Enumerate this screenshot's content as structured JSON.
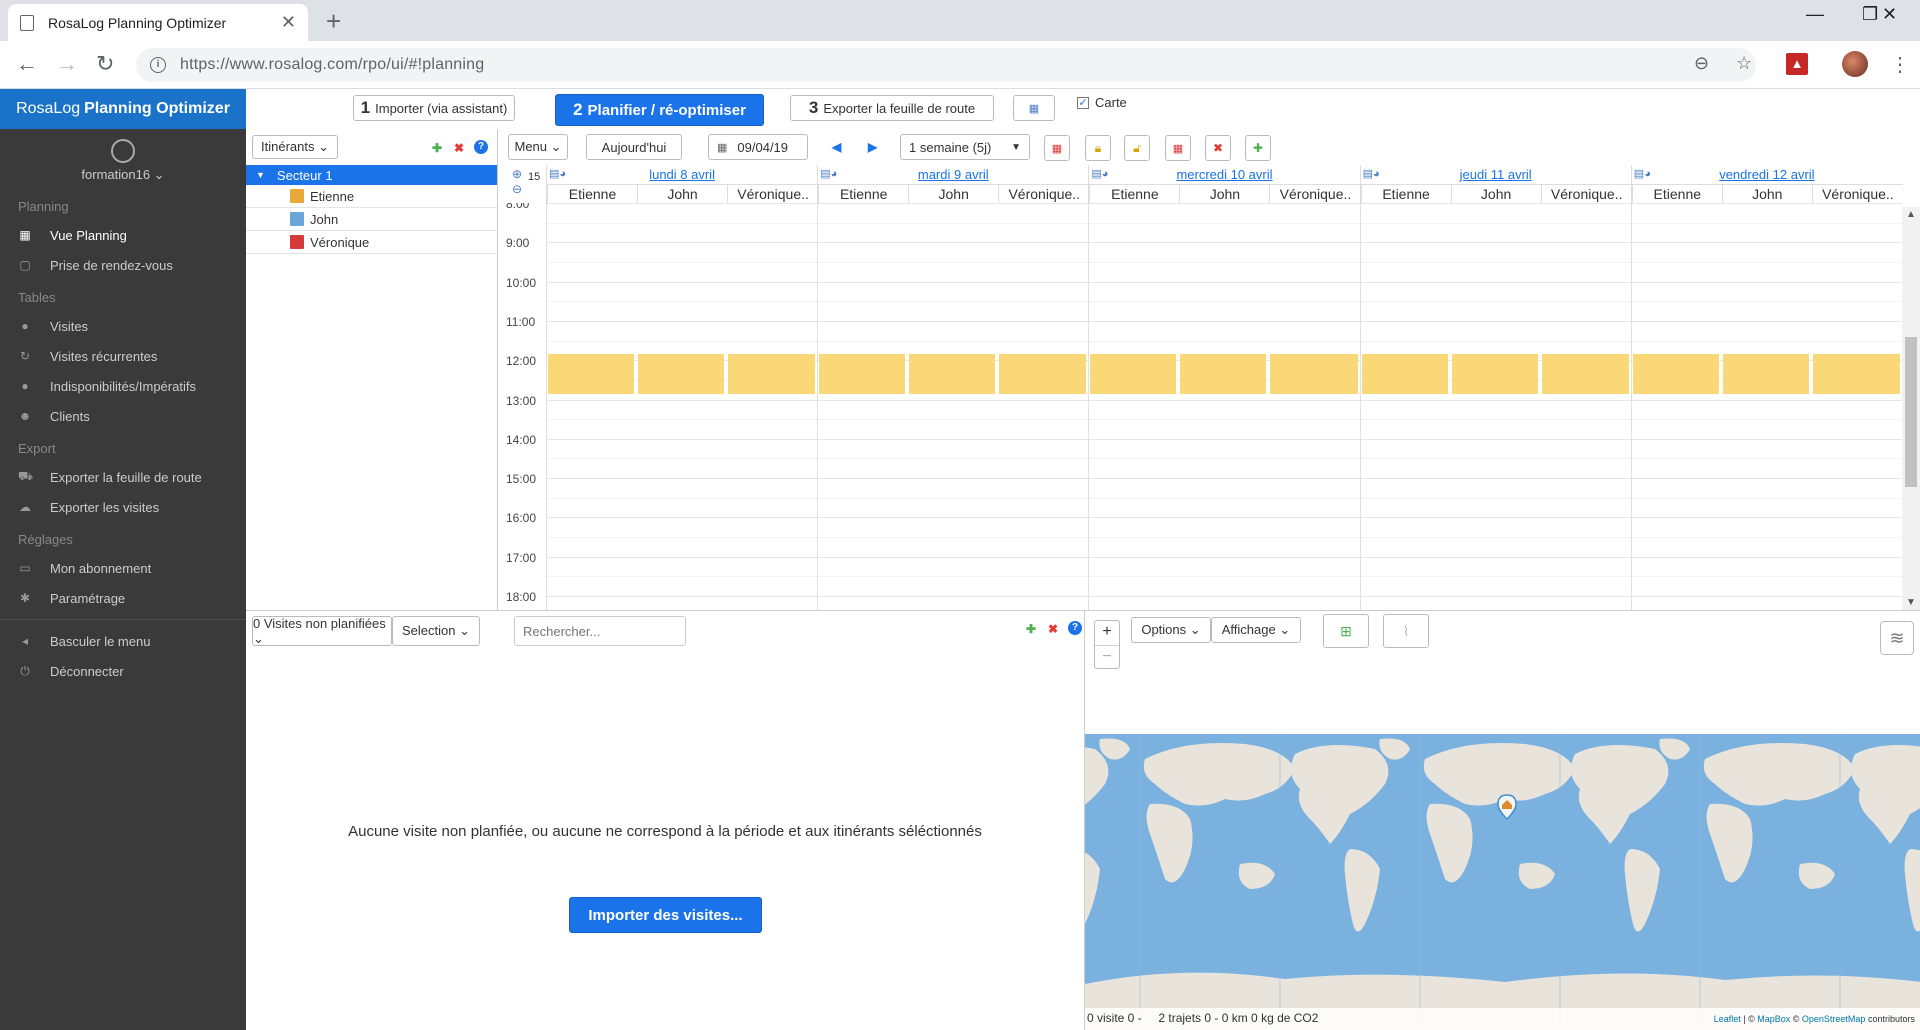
{
  "browser": {
    "tab_title": "RosaLog Planning Optimizer",
    "url": "https://www.rosalog.com/rpo/ui/#!planning"
  },
  "sidebar": {
    "brand_prefix": "RosaLog",
    "brand_suffix": "Planning Optimizer",
    "user": "formation16 ⌄",
    "sections": [
      {
        "title": "Planning",
        "items": [
          {
            "label": "Vue Planning",
            "icon": "calendar-icon",
            "active": true
          },
          {
            "label": "Prise de rendez-vous",
            "icon": "calendar-outline-icon"
          }
        ]
      },
      {
        "title": "Tables",
        "items": [
          {
            "label": "Visites",
            "icon": "map-pin-icon"
          },
          {
            "label": "Visites récurrentes",
            "icon": "refresh-icon"
          },
          {
            "label": "Indisponibilités/Impératifs",
            "icon": "alert-circle-icon"
          },
          {
            "label": "Clients",
            "icon": "users-icon"
          }
        ]
      },
      {
        "title": "Export",
        "items": [
          {
            "label": "Exporter la feuille de route",
            "icon": "car-icon"
          },
          {
            "label": "Exporter les visites",
            "icon": "cloud-upload-icon"
          }
        ]
      },
      {
        "title": "Réglages",
        "items": [
          {
            "label": "Mon abonnement",
            "icon": "credit-card-icon"
          },
          {
            "label": "Paramétrage",
            "icon": "gear-icon"
          }
        ]
      }
    ],
    "footer_items": [
      {
        "label": "Basculer le menu",
        "icon": "caret-left-icon"
      },
      {
        "label": "Déconnecter",
        "icon": "power-icon"
      }
    ]
  },
  "toolbar": {
    "step1_num": "1",
    "step1_label": "Importer (via assistant)",
    "step2_num": "2",
    "step2_label": "Planifier / ré-optimiser",
    "step3_num": "3",
    "step3_label": "Exporter la feuille de route",
    "carte_label": "Carte"
  },
  "resources": {
    "dropdown": "Itinérants ⌄",
    "sector": "Secteur 1",
    "people": [
      {
        "name": "Etienne",
        "color": "#e8a93c"
      },
      {
        "name": "John",
        "color": "#6aa6d8"
      },
      {
        "name": "Véronique",
        "color": "#d43a3a"
      }
    ]
  },
  "calendar": {
    "menu_label": "Menu ⌄",
    "today_label": "Aujourd'hui",
    "date_value": "09/04/19",
    "range_label": "1 semaine (5j)",
    "zoom_level": "15",
    "days": [
      {
        "label": "lundi 8 avril"
      },
      {
        "label": "mardi 9 avril"
      },
      {
        "label": "mercredi 10 avril"
      },
      {
        "label": "jeudi 11 avril"
      },
      {
        "label": "vendredi 12 avril"
      }
    ],
    "columns": [
      "Etienne",
      "John",
      "Véronique.."
    ],
    "hours": [
      "8:00",
      "9:00",
      "10:00",
      "11:00",
      "12:00",
      "13:00",
      "14:00",
      "15:00",
      "16:00",
      "17:00",
      "18:00"
    ],
    "unavailable_color": "#fad878"
  },
  "unplanned": {
    "dropdown": "0 Visites non planifiées ⌄",
    "selection": "Selection ⌄",
    "search_placeholder": "Rechercher...",
    "empty_message": "Aucune visite non planfiée, ou aucune ne correspond à la période et aux itinérants séléctionnés",
    "import_button": "Importer des visites..."
  },
  "map": {
    "options": "Options ⌄",
    "display": "Affichage ⌄",
    "zoom_in": "+",
    "zoom_out": "−",
    "stat_visits": "0 visite 0 -",
    "stat_trips": "2 trajets 0 - 0 km 0 kg de CO2",
    "attr_leaflet": "Leaflet",
    "attr_mapbox": "MapBox",
    "attr_osm": "OpenStreetMap",
    "attr_contrib": "contributors"
  }
}
